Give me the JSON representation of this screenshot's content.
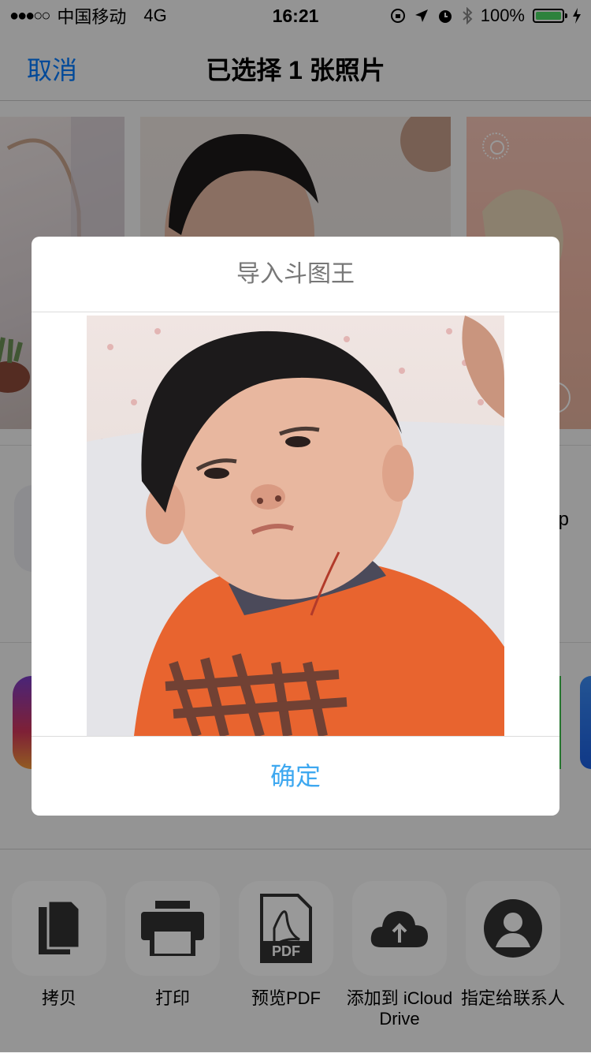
{
  "status_bar": {
    "signal": "●●●○○",
    "carrier": "中国移动",
    "network": "4G",
    "time": "16:21",
    "battery_percent": "100%",
    "icons": [
      "orientation-lock-icon",
      "location-arrow-icon",
      "alarm-icon",
      "bluetooth-icon",
      "battery-icon",
      "charging-icon"
    ]
  },
  "nav": {
    "cancel_label": "取消",
    "title": "已选择 1 张照片"
  },
  "share_sheet": {
    "partial_label": "p",
    "actions": [
      {
        "label": "拷贝",
        "icon": "copy-icon"
      },
      {
        "label": "打印",
        "icon": "printer-icon"
      },
      {
        "label": "预览PDF",
        "icon": "pdf-icon",
        "icon_text": "PDF"
      },
      {
        "label": "添加到 iCloud Drive",
        "icon": "icloud-upload-icon"
      },
      {
        "label": "指定给联系人",
        "icon": "contact-icon"
      }
    ]
  },
  "dialog": {
    "title": "导入斗图王",
    "confirm_label": "确定"
  },
  "colors": {
    "accent": "#007aff",
    "confirm": "#3ea8f0",
    "battery_green": "#4cd964",
    "shirt_orange": "#e8642f"
  }
}
